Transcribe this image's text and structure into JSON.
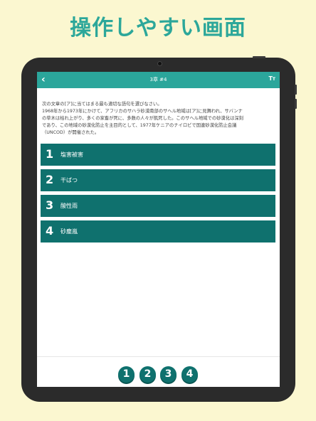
{
  "headline": "操作しやすい画面",
  "topbar": {
    "back_icon": "chevron-left-icon",
    "title": "3章 #4",
    "font_size_label": "T",
    "font_size_label_small": "T"
  },
  "question": {
    "lines": [
      "次の文章の[ア]に当てはまる最も適切な語句を選びなさい。",
      "1968年から1973年にかけて、アフリカのサハラ砂漠南部のサヘル地域は[ア]に見舞われ、サバンナ",
      "の草木は枯れ上がり、多くの家畜が死に、多数の人々が飢死した。このサヘル地域での砂漠化は深刻",
      "であり、この地域の砂漠化防止を主目的として、1977年ケニアのナイロビで国連砂漠化防止会議",
      "（UNCOD）が開催された。"
    ]
  },
  "choices": [
    {
      "num": "1",
      "label": "塩害被害"
    },
    {
      "num": "2",
      "label": "干ばつ"
    },
    {
      "num": "3",
      "label": "酸性雨"
    },
    {
      "num": "4",
      "label": "砂塵嵐"
    }
  ],
  "answer_buttons": [
    "1",
    "2",
    "3",
    "4"
  ],
  "colors": {
    "background": "#fbf7d0",
    "accent": "#2ba69b",
    "choice": "#0f716e"
  }
}
